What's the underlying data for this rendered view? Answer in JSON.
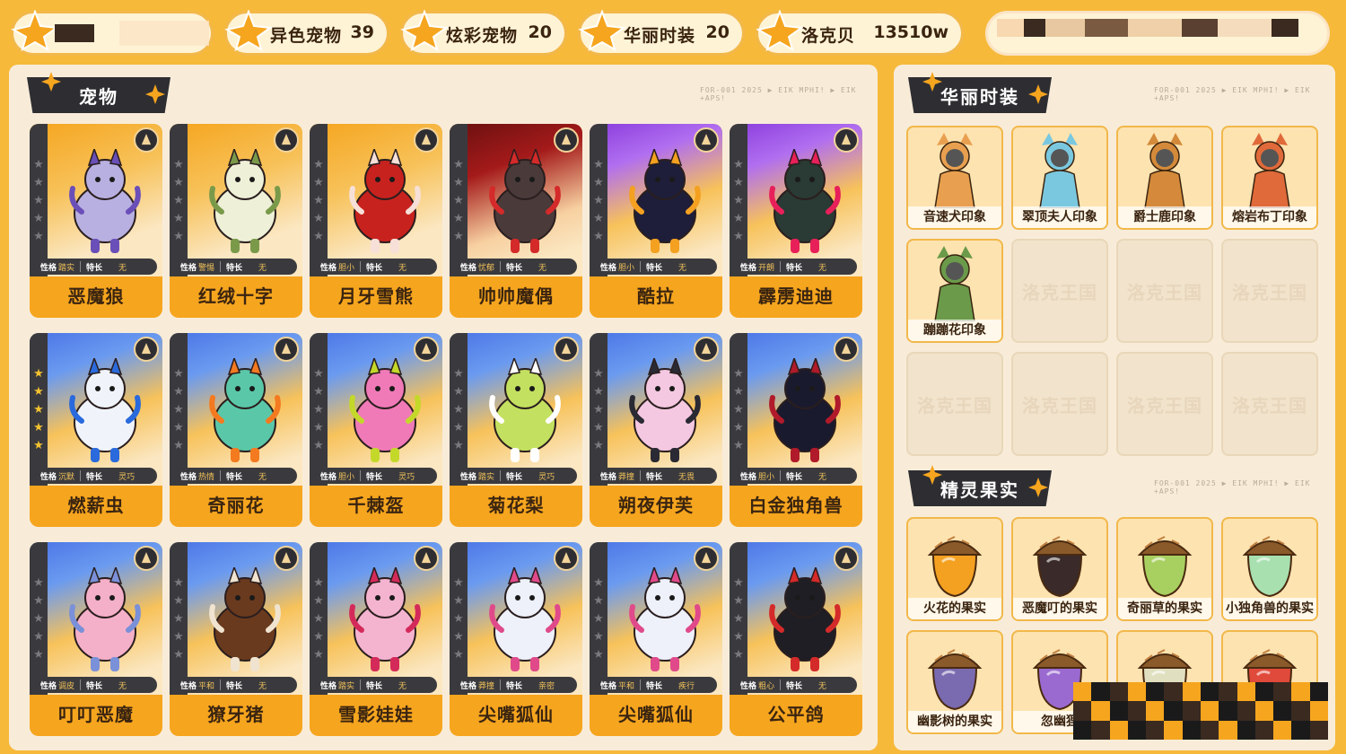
{
  "top_stats": [
    {
      "label": "",
      "value": ""
    },
    {
      "label": "异色宠物",
      "value": "39"
    },
    {
      "label": "炫彩宠物",
      "value": "20"
    },
    {
      "label": "华丽时装",
      "value": "20"
    },
    {
      "label": "洛克贝",
      "value": "13510w"
    }
  ],
  "pets_section": {
    "title": "宠物",
    "deco": "FOR-001   2025   ▶ EIK MPHI! ▶ EIK +APS!",
    "trait_key_nature": "性格",
    "trait_key_special": "特长",
    "pets": [
      {
        "name": "恶魔狼",
        "nature": "踏实",
        "special": "无",
        "theme": "orange",
        "body": "#b8b0e0",
        "accent": "#6a4fb8"
      },
      {
        "name": "红绒十字",
        "nature": "警惕",
        "special": "无",
        "theme": "orange",
        "body": "#eef0d8",
        "accent": "#7a9a4a"
      },
      {
        "name": "月牙雪熊",
        "nature": "胆小",
        "special": "无",
        "theme": "orange",
        "body": "#c8221e",
        "accent": "#f6e0d8"
      },
      {
        "name": "帅帅魔偶",
        "nature": "忧郁",
        "special": "无",
        "theme": "red",
        "body": "#4a3a3a",
        "accent": "#d42a2a"
      },
      {
        "name": "酷拉",
        "nature": "胆小",
        "special": "无",
        "theme": "purple",
        "body": "#1e1e3a",
        "accent": "#f4a020"
      },
      {
        "name": "霹雳迪迪",
        "nature": "开朗",
        "special": "无",
        "theme": "purple",
        "body": "#2a3a34",
        "accent": "#e8205a"
      },
      {
        "name": "燃薪虫",
        "nature": "沉默",
        "special": "灵巧",
        "theme": "blue",
        "body": "#f0f4fa",
        "accent": "#2a6adc"
      },
      {
        "name": "奇丽花",
        "nature": "热情",
        "special": "无",
        "theme": "blue",
        "body": "#5ac8a8",
        "accent": "#f47a20"
      },
      {
        "name": "千棘盔",
        "nature": "胆小",
        "special": "灵巧",
        "theme": "blue",
        "body": "#f07ab8",
        "accent": "#c4d82a"
      },
      {
        "name": "菊花梨",
        "nature": "踏实",
        "special": "灵巧",
        "theme": "blue",
        "body": "#c4e060",
        "accent": "#ffffff"
      },
      {
        "name": "朔夜伊芙",
        "nature": "莽撞",
        "special": "无畏",
        "theme": "blue",
        "body": "#f4c8e0",
        "accent": "#2a2a34"
      },
      {
        "name": "白金独角兽",
        "nature": "胆小",
        "special": "无",
        "theme": "blue",
        "body": "#1a1a2e",
        "accent": "#b01a2a"
      },
      {
        "name": "叮叮恶魔",
        "nature": "调皮",
        "special": "无",
        "theme": "blue",
        "body": "#f4b0c8",
        "accent": "#7a90d8"
      },
      {
        "name": "獠牙猪",
        "nature": "平和",
        "special": "无",
        "theme": "blue",
        "body": "#6a3a1e",
        "accent": "#f0e4d0"
      },
      {
        "name": "雪影娃娃",
        "nature": "踏实",
        "special": "无",
        "theme": "blue",
        "body": "#f4b4d0",
        "accent": "#d42a5a"
      },
      {
        "name": "尖嘴狐仙",
        "nature": "莽撞",
        "special": "亲密",
        "theme": "blue",
        "body": "#eef0fa",
        "accent": "#e04a8a"
      },
      {
        "name": "尖嘴狐仙",
        "nature": "平和",
        "special": "疾行",
        "theme": "blue",
        "body": "#eef0fa",
        "accent": "#e04a8a"
      },
      {
        "name": "公平鸽",
        "nature": "粗心",
        "special": "无",
        "theme": "blue",
        "body": "#1e1e24",
        "accent": "#d42a2a"
      }
    ]
  },
  "outfits_section": {
    "title": "华丽时装",
    "deco": "FOR-001   2025   ▶ EIK MPHI! ▶ EIK +APS!",
    "empty_label": "洛克王国",
    "items": [
      {
        "name": "音速犬印象",
        "color": "#e8a050"
      },
      {
        "name": "翠顶夫人印象",
        "color": "#7ac8e0"
      },
      {
        "name": "爵士鹿印象",
        "color": "#d48a3a"
      },
      {
        "name": "熔岩布丁印象",
        "color": "#e06a3a"
      },
      {
        "name": "蹦蹦花印象",
        "color": "#6a9a4a"
      },
      {
        "name": "",
        "color": ""
      },
      {
        "name": "",
        "color": ""
      },
      {
        "name": "",
        "color": ""
      },
      {
        "name": "",
        "color": ""
      },
      {
        "name": "",
        "color": ""
      },
      {
        "name": "",
        "color": ""
      },
      {
        "name": "",
        "color": ""
      }
    ]
  },
  "fruits_section": {
    "title": "精灵果实",
    "deco": "FOR-001   2025   ▶ EIK MPHI! ▶ EIK +APS!",
    "items": [
      {
        "name": "火花的果实",
        "color": "#f4a020"
      },
      {
        "name": "恶魔叮的果实",
        "color": "#3a2a2a"
      },
      {
        "name": "奇丽草的果实",
        "color": "#a8d060"
      },
      {
        "name": "小独角兽的果实",
        "color": "#a8e0b0"
      },
      {
        "name": "幽影树的果实",
        "color": "#7a6ab0"
      },
      {
        "name": "忽幽狸",
        "color": "#9a6ad0"
      },
      {
        "name": "",
        "color": "#e0e0c0"
      },
      {
        "name": "",
        "color": "#e04a3a"
      }
    ]
  }
}
